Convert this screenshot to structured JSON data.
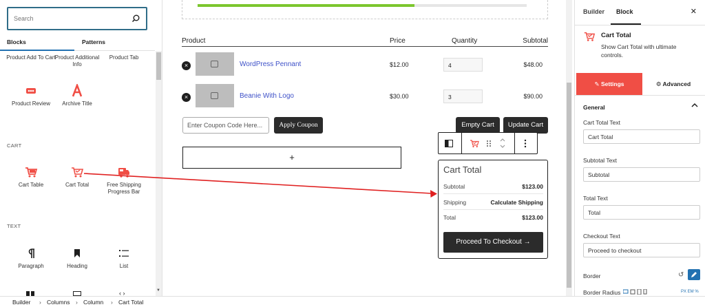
{
  "search": {
    "placeholder": "Search"
  },
  "inserter_tabs": {
    "blocks": "Blocks",
    "patterns": "Patterns"
  },
  "block_items_top": [
    {
      "label": "Product Add To Cart"
    },
    {
      "label": "Product Additional Info"
    },
    {
      "label": "Product Tab"
    },
    {
      "label": "Product Review"
    },
    {
      "label": "Archive Title"
    }
  ],
  "sections": {
    "cart": "CART",
    "text": "TEXT"
  },
  "cart_blocks": [
    {
      "label": "Cart Table"
    },
    {
      "label": "Cart Total"
    },
    {
      "label": "Free Shipping Progress Bar"
    }
  ],
  "text_blocks": [
    {
      "label": "Paragraph"
    },
    {
      "label": "Heading"
    },
    {
      "label": "List"
    }
  ],
  "cart_table": {
    "progress_fraction": 0.66,
    "headers": {
      "product": "Product",
      "price": "Price",
      "quantity": "Quantity",
      "subtotal": "Subtotal"
    },
    "rows": [
      {
        "name": "WordPress Pennant",
        "price": "$12.00",
        "qty": "4",
        "subtotal": "$48.00"
      },
      {
        "name": "Beanie With Logo",
        "price": "$30.00",
        "qty": "3",
        "subtotal": "$90.00"
      }
    ],
    "coupon_placeholder": "Enter Coupon Code Here...",
    "apply_coupon": "Apply Coupon",
    "empty_cart": "Empty Cart",
    "update_cart": "Update Cart",
    "add_block": "+"
  },
  "cart_total": {
    "title": "Cart Total",
    "subtotal_label": "Subtotal",
    "subtotal_value": "$123.00",
    "shipping_label": "Shipping",
    "shipping_value": "Calculate Shipping",
    "total_label": "Total",
    "total_value": "$123.00",
    "checkout": "Proceed To Checkout →"
  },
  "sidebar": {
    "tab_builder": "Builder",
    "tab_block": "Block",
    "close": "✕",
    "block_title": "Cart Total",
    "block_desc": "Show Cart Total with ultimate controls.",
    "settings_tab": "Settings",
    "advanced_tab": "Advanced",
    "general": "General",
    "fields": [
      {
        "label": "Cart Total Text",
        "value": "Cart Total"
      },
      {
        "label": "Subtotal Text",
        "value": "Subtotal"
      },
      {
        "label": "Total Text",
        "value": "Total"
      },
      {
        "label": "Checkout Text",
        "value": "Proceed to checkout"
      }
    ],
    "border_label": "Border",
    "radius_label": "Border Radius",
    "radius_units": "PX  EM  %"
  },
  "breadcrumb": [
    "Builder",
    "Columns",
    "Column",
    "Cart Total"
  ],
  "colors": {
    "accent": "#f04e45",
    "wp_blue": "#2271b1",
    "progress": "#7cc62e",
    "link": "#3d50c8",
    "arrow": "#e02020"
  },
  "icons": [
    "search-icon",
    "cart-table-icon",
    "cart-total-icon",
    "shipping-bar-icon",
    "paragraph-icon",
    "heading-icon",
    "list-icon",
    "close-icon",
    "chevron-up-icon",
    "advanced-gear-icon",
    "settings-wrench-icon"
  ]
}
